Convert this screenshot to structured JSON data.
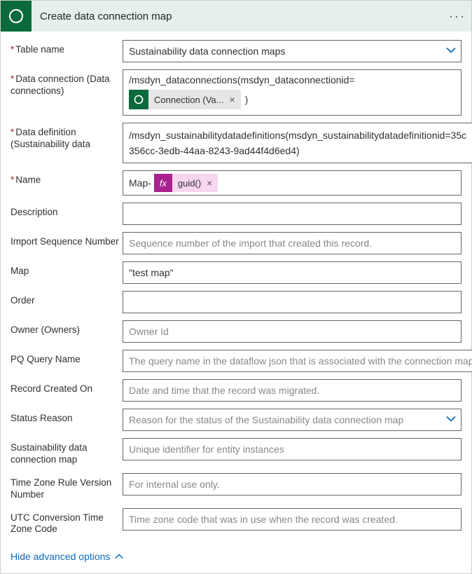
{
  "header": {
    "title": "Create data connection map",
    "more": "···"
  },
  "labels": {
    "table_name": "Table name",
    "data_connection": "Data connection (Data connections)",
    "data_definition": "Data definition (Sustainability data",
    "name": "Name",
    "description": "Description",
    "import_seq": "Import Sequence Number",
    "map": "Map",
    "order": "Order",
    "owner": "Owner (Owners)",
    "pq_query": "PQ Query Name",
    "record_created_on": "Record Created On",
    "status_reason": "Status Reason",
    "scm": "Sustainability data connection map",
    "tzrv": "Time Zone Rule Version Number",
    "utc": "UTC Conversion Time Zone Code"
  },
  "values": {
    "table_name": "Sustainability data connection maps",
    "data_connection_pre": "/msdyn_dataconnections(msdyn_dataconnectionid=",
    "data_connection_token": "Connection (Va...",
    "data_connection_post": ")",
    "data_definition_line1": "/msdyn_sustainabilitydatadefinitions(msdyn_sustainabilitydatadefinitionid=35c",
    "data_definition_line2": "356cc-3edb-44aa-8243-9ad44f4d6ed4)",
    "name_prefix": "Map-",
    "name_fx": "guid()",
    "map": "\"test map\""
  },
  "placeholders": {
    "import_seq": "Sequence number of the import that created this record.",
    "owner": "Owner Id",
    "pq_query": "The query name in the dataflow json that is associated with the connection map",
    "record_created_on": "Date and time that the record was migrated.",
    "status_reason": "Reason for the status of the Sustainability data connection map",
    "scm": "Unique identifier for entity instances",
    "tzrv": "For internal use only.",
    "utc": "Time zone code that was in use when the record was created."
  },
  "footer": {
    "hide_advanced": "Hide advanced options"
  },
  "fx_badge": "fx",
  "token_close": "×"
}
